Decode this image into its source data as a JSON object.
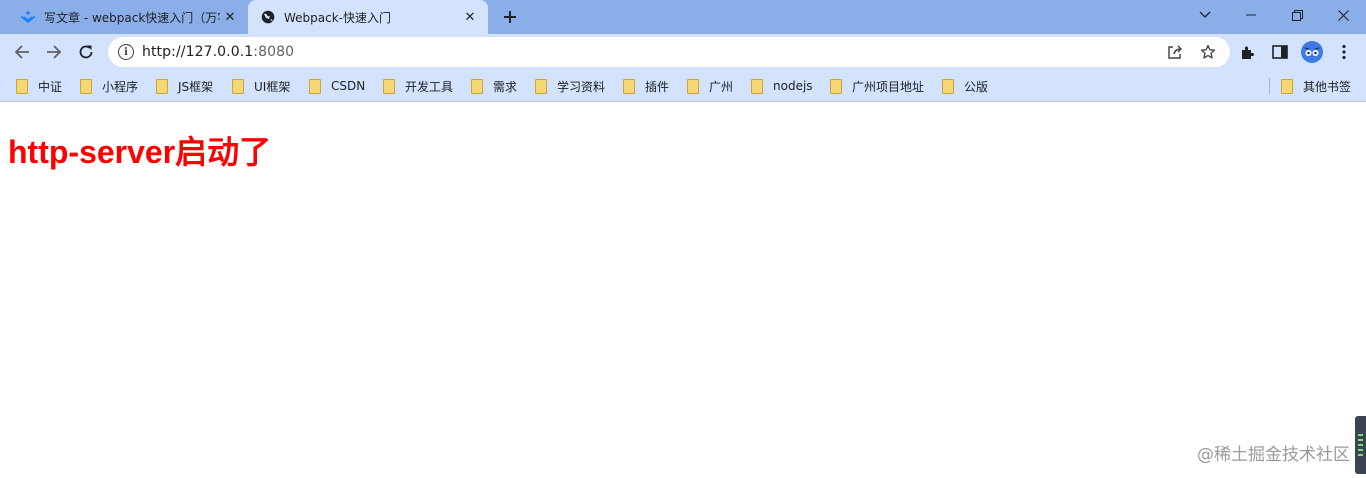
{
  "tabs": [
    {
      "title": "写文章 - webpack快速入门（万字",
      "icon": "juejin-logo-icon",
      "active": false
    },
    {
      "title": "Webpack-快速入门",
      "icon": "globe-icon",
      "active": true
    }
  ],
  "window_controls": [
    "tab-search",
    "minimize",
    "restore",
    "close"
  ],
  "address_bar": {
    "url_host": "http://127.0.0.1",
    "url_port": ":8080"
  },
  "bookmarks": [
    "中证",
    "小程序",
    "JS框架",
    "UI框架",
    "CSDN",
    "开发工具",
    "需求",
    "学习资料",
    "插件",
    "广州",
    "nodejs",
    "广州项目地址",
    "公版"
  ],
  "other_bookmarks": "其他书签",
  "page": {
    "headline": "http-server启动了"
  },
  "watermark": "@稀土掘金技术社区",
  "colors": {
    "headline": "#ff0000",
    "tabstrip": "#8aaee8",
    "toolbar": "#d3e3fd"
  }
}
